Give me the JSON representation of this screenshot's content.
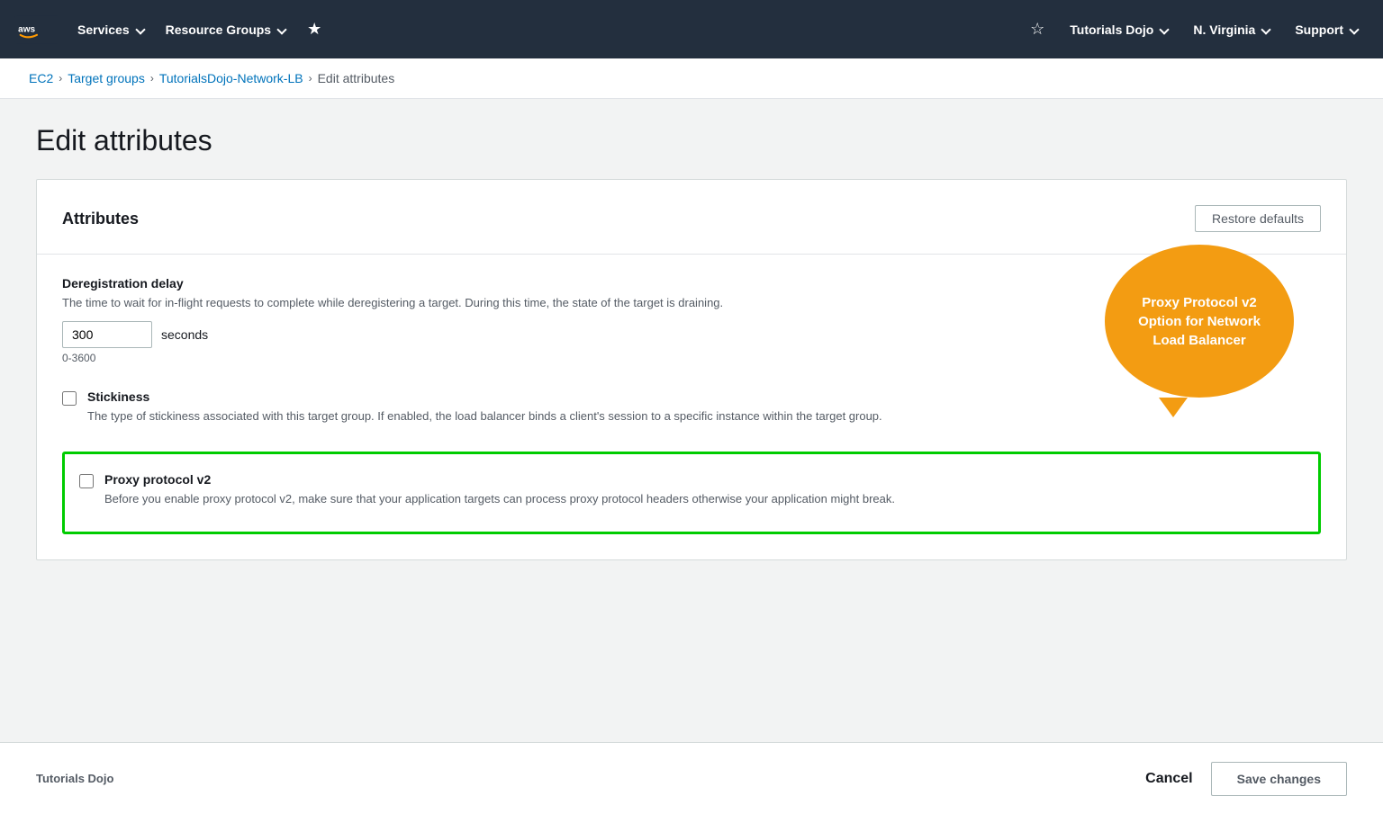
{
  "nav": {
    "services_label": "Services",
    "resource_groups_label": "Resource Groups",
    "tutorials_dojo_label": "Tutorials Dojo",
    "region_label": "N. Virginia",
    "support_label": "Support"
  },
  "breadcrumb": {
    "ec2": "EC2",
    "target_groups": "Target groups",
    "lb_name": "TutorialsDojo-Network-LB",
    "current": "Edit attributes"
  },
  "page": {
    "title": "Edit attributes"
  },
  "card": {
    "title": "Attributes",
    "restore_btn": "Restore defaults"
  },
  "deregistration": {
    "label": "Deregistration delay",
    "description": "The time to wait for in-flight requests to complete while deregistering a target. During this time, the state of the target is draining.",
    "value": "300",
    "unit": "seconds",
    "range": "0-3600"
  },
  "stickiness": {
    "label": "Stickiness",
    "description": "The type of stickiness associated with this target group. If enabled, the load balancer binds a client's session to a specific instance within the target group."
  },
  "proxy_protocol": {
    "label": "Proxy protocol v2",
    "description": "Before you enable proxy protocol v2, make sure that your application targets can process proxy protocol headers otherwise your application might break."
  },
  "callout": {
    "text": "Proxy Protocol v2 Option for Network Load Balancer"
  },
  "footer": {
    "brand": "Tutorials Dojo",
    "cancel_label": "Cancel",
    "save_label": "Save changes"
  }
}
